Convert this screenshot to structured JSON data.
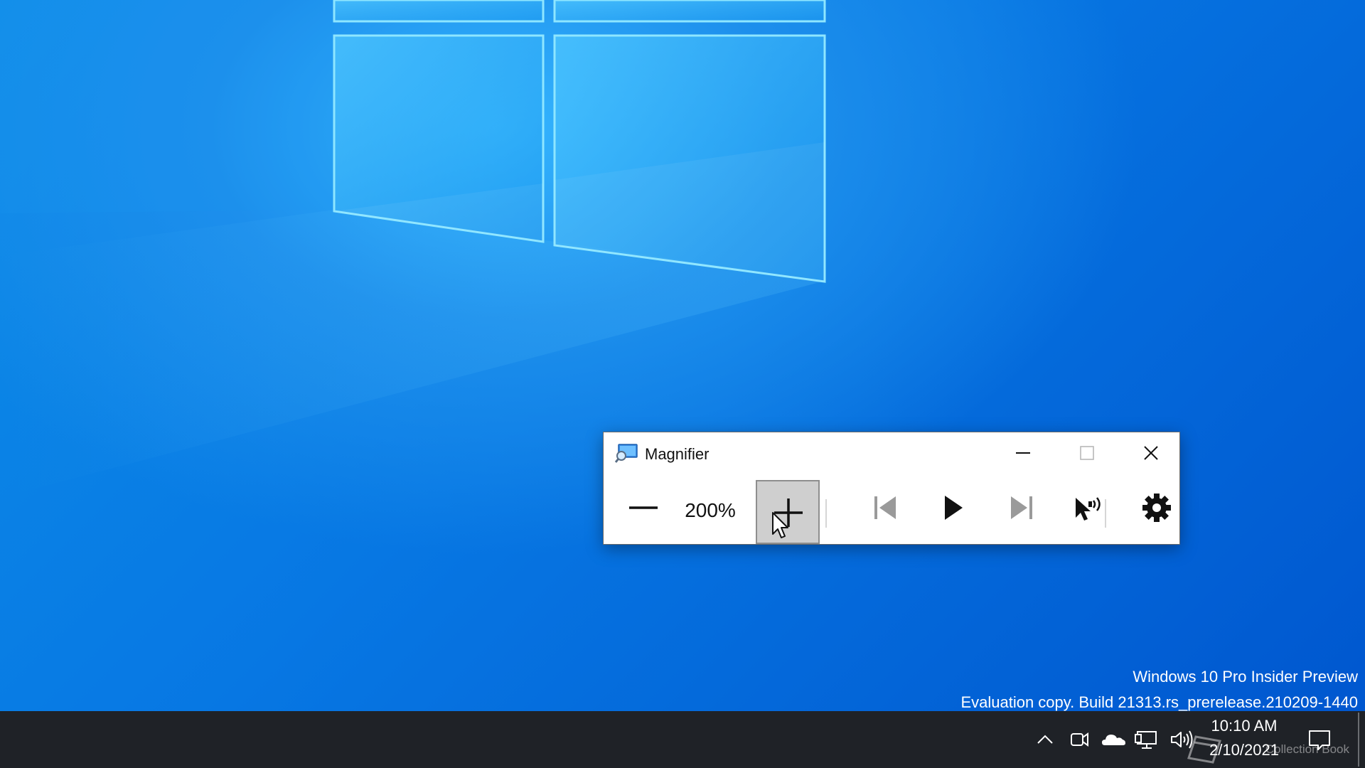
{
  "magnifier": {
    "title": "Magnifier",
    "icon": "magnifier-app-icon",
    "zoom_level": "200%",
    "buttons": {
      "minimize": "minimize-icon",
      "maximize": "maximize-icon",
      "close": "close-icon",
      "zoom_out": "minus-icon",
      "zoom_in": "plus-icon",
      "previous": "skip-previous-icon",
      "play": "play-icon",
      "next": "skip-next-icon",
      "read_from_here": "read-from-here-icon",
      "settings": "gear-icon"
    }
  },
  "watermark": {
    "line1": "Windows 10 Pro Insider Preview",
    "line2": "Evaluation copy. Build 21313.rs_prerelease.210209-1440"
  },
  "taskbar": {
    "tray_icons": [
      "chevron-up-icon",
      "meet-now-icon",
      "onedrive-cloud-icon",
      "network-icon",
      "volume-icon",
      "action-center-icon"
    ],
    "clock_time": "10:10 AM",
    "clock_date": "2/10/2021",
    "overlay_text": "Collection Book"
  },
  "colors": {
    "desktop_blue": "#0063d8",
    "taskbar": "#1f2227",
    "zoom_in_pressed": "#cfcfcf"
  }
}
